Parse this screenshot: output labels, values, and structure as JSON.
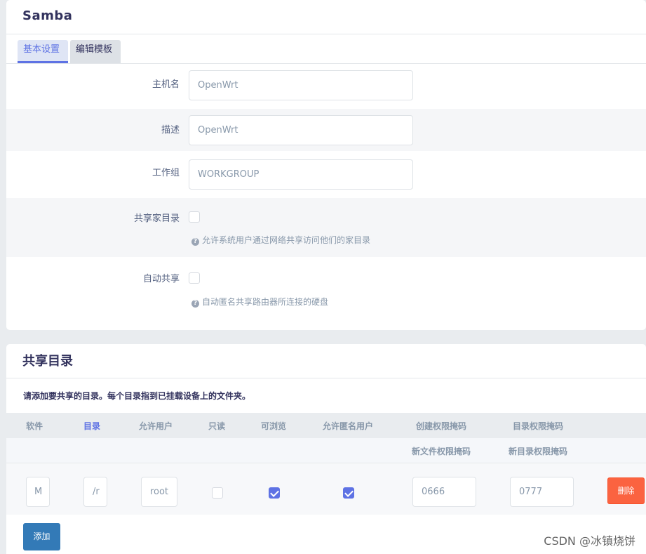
{
  "section1": {
    "title": "Samba",
    "tabs": [
      "基本设置",
      "编辑模板"
    ],
    "fields": {
      "hostname": {
        "label": "主机名",
        "value": "OpenWrt"
      },
      "description": {
        "label": "描述",
        "value": "OpenWrt"
      },
      "workgroup": {
        "label": "工作组",
        "value": "WORKGROUP"
      }
    },
    "share_home": {
      "label": "共享家目录",
      "checked": false,
      "hint": "允许系统用户通过网络共享访问他们的家目录"
    },
    "auto_share": {
      "label": "自动共享",
      "checked": false,
      "hint": "自动匿名共享路由器所连接的硬盘"
    }
  },
  "section2": {
    "title": "共享目录",
    "description": "请添加要共享的目录。每个目录指到已挂载设备上的文件夹。",
    "headers": [
      "软件",
      "目录",
      "允许用户",
      "只读",
      "可浏览",
      "允许匿名用户",
      "创建权限掩码",
      "目录权限掩码"
    ],
    "subheaders": [
      "新文件权限掩码",
      "新目录权限掩码"
    ],
    "row": {
      "software": "M",
      "directory": "/r",
      "users": "root",
      "readonly": false,
      "browseable": true,
      "guest_ok": true,
      "create_mask": "0666",
      "dir_mask": "0777",
      "delete_label": "删除"
    },
    "add_label": "添加"
  },
  "watermark": "CSDN @冰镇烧饼"
}
